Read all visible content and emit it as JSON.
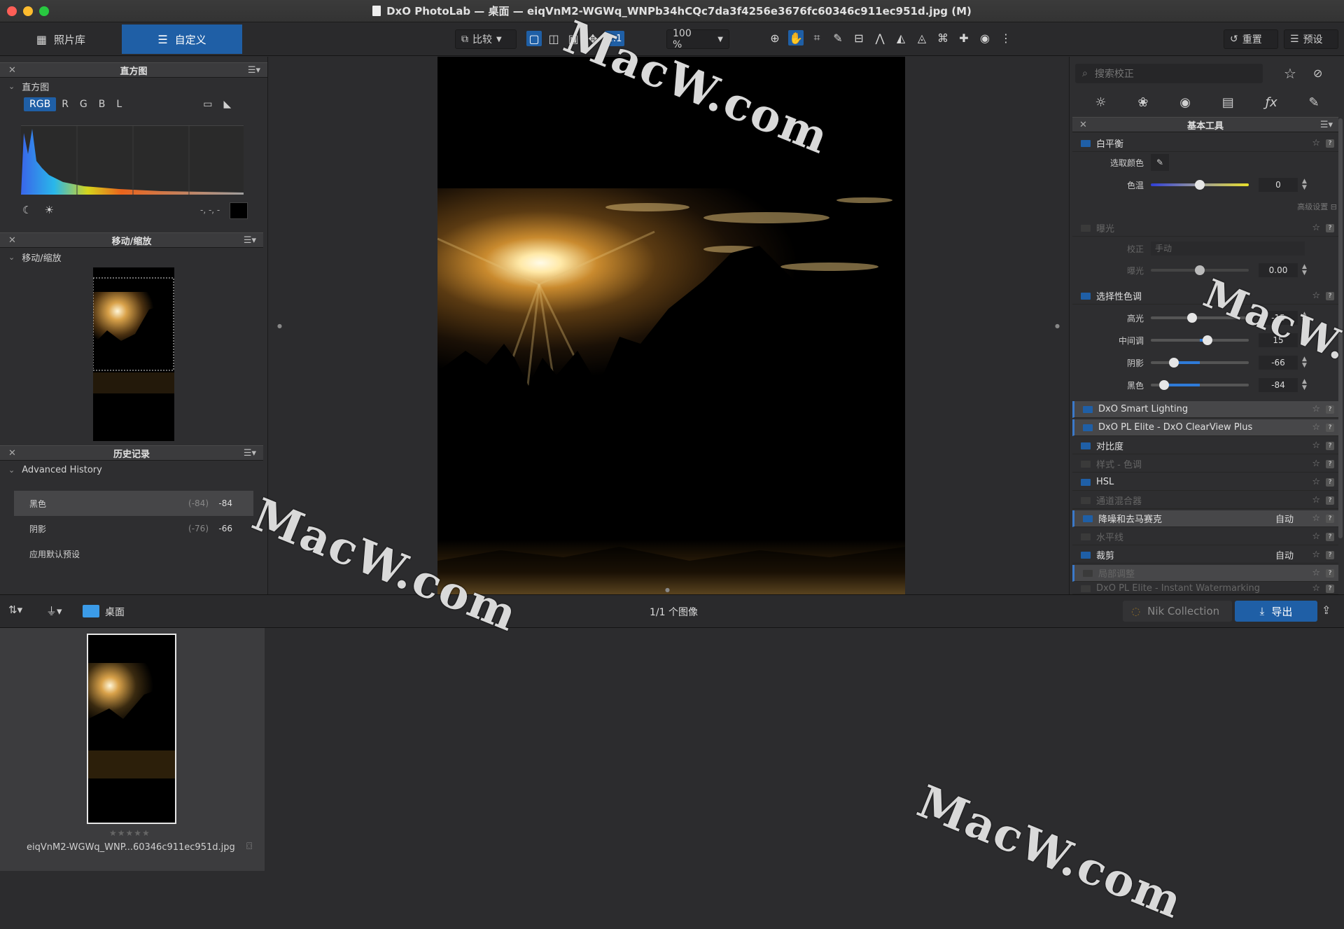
{
  "window": {
    "title": "DxO PhotoLab — 桌面 — eiqVnM2-WGWq_WNPb34hCQc7da3f4256e3676fc60346c911ec951d.jpg (M)"
  },
  "toolbar": {
    "tab_library": "照片库",
    "tab_custom": "自定义",
    "compare": "比较",
    "one_to_one": "1:1",
    "zoom": "100 %",
    "reset": "重置",
    "presets": "预设"
  },
  "left": {
    "histogram_panel": "直方图",
    "histogram_sub": "直方图",
    "channels": [
      "RGB",
      "R",
      "G",
      "B",
      "L"
    ],
    "histogram_readout": "-, -, -",
    "move_panel": "移动/缩放",
    "move_sub": "移动/缩放",
    "history_panel": "历史记录",
    "history_sub": "Advanced History",
    "history": [
      {
        "label": "黑色",
        "old": "(-84)",
        "new": "-84"
      },
      {
        "label": "阴影",
        "old": "(-76)",
        "new": "-66"
      },
      {
        "label": "应用默认预设",
        "old": "",
        "new": ""
      }
    ]
  },
  "right": {
    "search_placeholder": "搜索校正",
    "panel_title": "基本工具",
    "white_balance": "白平衡",
    "pick_color": "选取颜色",
    "temp_label": "色温",
    "temp_value": "0",
    "advanced": "高级设置",
    "exposure": "曝光",
    "correction_label": "校正",
    "correction_value": "手动",
    "exposure_label": "曝光",
    "exposure_value": "0.00",
    "selective_tone": "选择性色调",
    "highlights_label": "高光",
    "highlights_value": "-15",
    "midtones_label": "中间调",
    "midtones_value": "15",
    "shadows_label": "阴影",
    "shadows_value": "-66",
    "blacks_label": "黑色",
    "blacks_value": "-84",
    "tools": [
      {
        "label": "DxO Smart Lighting",
        "auto": ""
      },
      {
        "label": "DxO PL Elite - DxO ClearView Plus",
        "auto": ""
      },
      {
        "label": "对比度",
        "auto": ""
      },
      {
        "label": "样式 - 色调",
        "auto": ""
      },
      {
        "label": "HSL",
        "auto": ""
      },
      {
        "label": "通道混合器",
        "auto": ""
      },
      {
        "label": "降噪和去马赛克",
        "auto": "自动"
      },
      {
        "label": "水平线",
        "auto": ""
      },
      {
        "label": "裁剪",
        "auto": "自动"
      },
      {
        "label": "局部调整",
        "auto": ""
      },
      {
        "label": "DxO PL Elite - Instant Watermarking",
        "auto": ""
      }
    ]
  },
  "bottom": {
    "folder": "桌面",
    "count": "1/1 个图像",
    "nik": "Nik Collection",
    "export": "导出",
    "filename": "eiqVnM2-WGWq_WNP...60346c911ec951d.jpg"
  },
  "watermark": "MacW.com",
  "colors": {
    "accent": "#1f5fa6",
    "close": "#ff5f57",
    "minimize": "#febc2e",
    "zoom": "#28c840"
  }
}
